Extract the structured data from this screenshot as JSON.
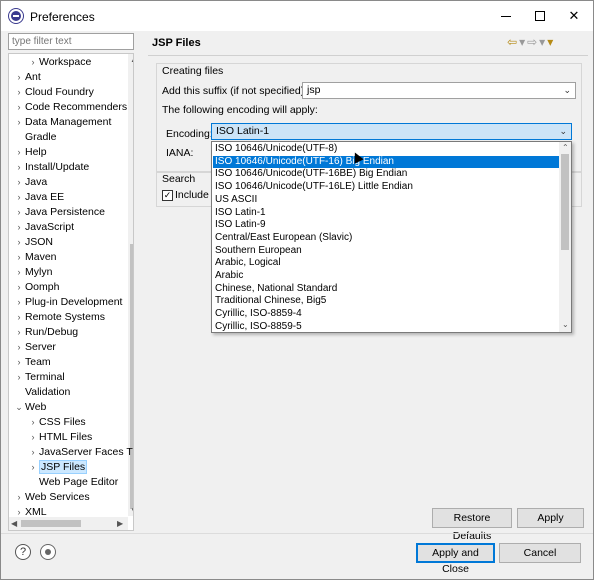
{
  "window": {
    "title": "Preferences",
    "controls": {
      "minimize": "",
      "maximize": "",
      "close": "✕"
    }
  },
  "filter": {
    "placeholder": "type filter text"
  },
  "tree": {
    "items": [
      {
        "label": "Workspace",
        "toggle": "›",
        "level": 1
      },
      {
        "label": "Ant",
        "toggle": "›",
        "level": 0
      },
      {
        "label": "Cloud Foundry",
        "toggle": "›",
        "level": 0
      },
      {
        "label": "Code Recommenders",
        "toggle": "›",
        "level": 0
      },
      {
        "label": "Data Management",
        "toggle": "›",
        "level": 0
      },
      {
        "label": "Gradle",
        "toggle": "",
        "level": 0
      },
      {
        "label": "Help",
        "toggle": "›",
        "level": 0
      },
      {
        "label": "Install/Update",
        "toggle": "›",
        "level": 0
      },
      {
        "label": "Java",
        "toggle": "›",
        "level": 0
      },
      {
        "label": "Java EE",
        "toggle": "›",
        "level": 0
      },
      {
        "label": "Java Persistence",
        "toggle": "›",
        "level": 0
      },
      {
        "label": "JavaScript",
        "toggle": "›",
        "level": 0
      },
      {
        "label": "JSON",
        "toggle": "›",
        "level": 0
      },
      {
        "label": "Maven",
        "toggle": "›",
        "level": 0
      },
      {
        "label": "Mylyn",
        "toggle": "›",
        "level": 0
      },
      {
        "label": "Oomph",
        "toggle": "›",
        "level": 0
      },
      {
        "label": "Plug-in Development",
        "toggle": "›",
        "level": 0
      },
      {
        "label": "Remote Systems",
        "toggle": "›",
        "level": 0
      },
      {
        "label": "Run/Debug",
        "toggle": "›",
        "level": 0
      },
      {
        "label": "Server",
        "toggle": "›",
        "level": 0
      },
      {
        "label": "Team",
        "toggle": "›",
        "level": 0
      },
      {
        "label": "Terminal",
        "toggle": "›",
        "level": 0
      },
      {
        "label": "Validation",
        "toggle": "",
        "level": 0
      },
      {
        "label": "Web",
        "toggle": "⌄",
        "level": 0
      },
      {
        "label": "CSS Files",
        "toggle": "›",
        "level": 1
      },
      {
        "label": "HTML Files",
        "toggle": "›",
        "level": 1
      },
      {
        "label": "JavaServer Faces T",
        "toggle": "›",
        "level": 1
      },
      {
        "label": "JSP Files",
        "toggle": "›",
        "level": 1,
        "selected": true
      },
      {
        "label": "Web Page Editor",
        "toggle": "",
        "level": 1
      },
      {
        "label": "Web Services",
        "toggle": "›",
        "level": 0
      },
      {
        "label": "XML",
        "toggle": "›",
        "level": 0
      }
    ]
  },
  "page": {
    "title": "JSP Files",
    "nav": {
      "back": "⇦",
      "back_menu": "▾",
      "forward": "⇨",
      "forward_menu": "▾",
      "view_menu": "▾"
    }
  },
  "creating": {
    "group_label": "Creating files",
    "suffix_label": "Add this suffix (if not specified):",
    "suffix_value": "jsp",
    "encoding_note": "The following encoding will apply:",
    "encoding_label": "Encoding:",
    "encoding_value": "ISO Latin-1",
    "iana_label": "IANA:"
  },
  "search": {
    "group_label": "Search",
    "include_label": "Include J",
    "checked": "✓"
  },
  "encoding_options": [
    "ISO 10646/Unicode(UTF-8)",
    "ISO 10646/Unicode(UTF-16) Big Endian",
    "ISO 10646/Unicode(UTF-16BE) Big Endian",
    "ISO 10646/Unicode(UTF-16LE) Little Endian",
    "US ASCII",
    "ISO Latin-1",
    "ISO Latin-9",
    "Central/East European (Slavic)",
    "Southern European",
    "Arabic, Logical",
    "Arabic",
    "Chinese, National Standard",
    "Traditional Chinese, Big5",
    "Cyrillic, ISO-8859-4",
    "Cyrillic, ISO-8859-5"
  ],
  "highlighted_option": "ISO 10646/Unicode(UTF-16) Big Endian",
  "buttons": {
    "restore_defaults": "Restore Defaults",
    "apply": "Apply",
    "apply_and_close": "Apply and Close",
    "cancel": "Cancel"
  },
  "footer": {
    "help": "?"
  },
  "colors": {
    "selection": "#0078d7",
    "tree_selection": "#cce8ff"
  }
}
